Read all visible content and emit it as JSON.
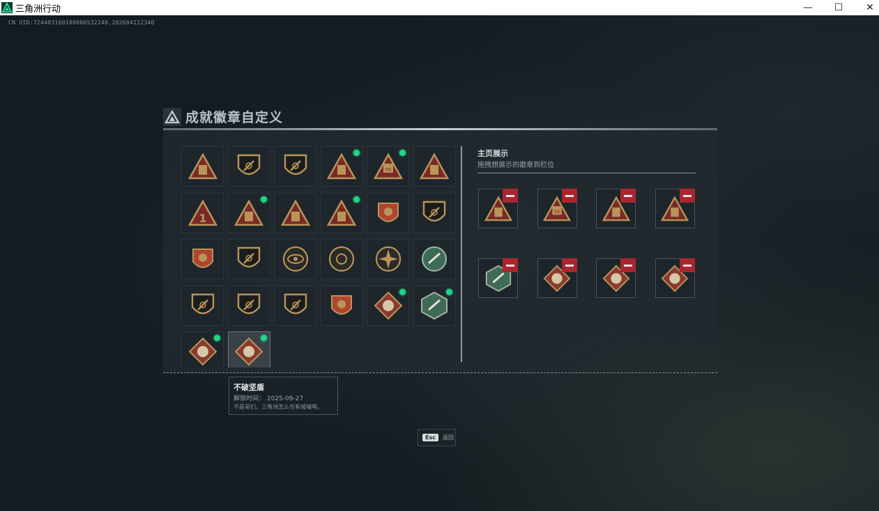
{
  "window": {
    "title": "三角洲行动",
    "minimize": "—",
    "maximize": "☐",
    "close": "✕"
  },
  "uid": "CN UID:7244031601000065322​40,20260411234​0",
  "header": {
    "title": "成就徽章自定义"
  },
  "badges": [
    {
      "icon": "shield-triangle-badge",
      "new": false
    },
    {
      "icon": "helicopter-shield-badge",
      "new": false
    },
    {
      "icon": "arrow-shield-badge",
      "new": false
    },
    {
      "icon": "bag-triangle-badge",
      "new": true
    },
    {
      "icon": "vest-56-badge",
      "new": true
    },
    {
      "icon": "helmet-triangle-badge",
      "new": false
    },
    {
      "icon": "number-1-badge",
      "new": false
    },
    {
      "icon": "box-triangle-badge",
      "new": true
    },
    {
      "icon": "tent-triangle-badge",
      "new": false
    },
    {
      "icon": "rocket-triangle-badge",
      "new": true
    },
    {
      "icon": "star-medal-badge",
      "new": false
    },
    {
      "icon": "hand-shield-badge",
      "new": false
    },
    {
      "icon": "winged-medal-badge",
      "new": false
    },
    {
      "icon": "beast-shield-badge",
      "new": false
    },
    {
      "icon": "eye-badge",
      "new": false
    },
    {
      "icon": "flower-badge",
      "new": false
    },
    {
      "icon": "compass-star-badge",
      "new": false
    },
    {
      "icon": "rifle-hex-badge",
      "new": false
    },
    {
      "icon": "rifle-shield-badge",
      "new": false
    },
    {
      "icon": "sniper-shield-badge",
      "new": false
    },
    {
      "icon": "gun-shield-badge",
      "new": false
    },
    {
      "icon": "crest-banner-badge",
      "new": false
    },
    {
      "icon": "beast-diamond-badge",
      "new": true
    },
    {
      "icon": "wasp-hex-badge",
      "new": true
    },
    {
      "icon": "dragon-diamond-badge",
      "new": true
    },
    {
      "icon": "armor-diamond-badge",
      "new": true
    }
  ],
  "showcase": {
    "title": "主页展示",
    "subtitle": "拖拽想展示的徽章到栏位",
    "slots": [
      {
        "icon": "box-triangle-badge"
      },
      {
        "icon": "vest-56-badge"
      },
      {
        "icon": "bag-triangle-badge"
      },
      {
        "icon": "rocket-triangle-badge"
      },
      {
        "icon": "wasp-hex-badge"
      },
      {
        "icon": "armor-diamond-badge"
      },
      {
        "icon": "dragon-diamond-badge"
      },
      {
        "icon": "beast-diamond-badge"
      }
    ]
  },
  "tooltip": {
    "name": "不破坚盾",
    "unlock_label": "解锁时间：",
    "unlock_date": "2025-09-27",
    "unlock_line": "解锁时间：  2025-09-27",
    "desc": "不是哥们，三角洲怎么也有城墙啊。"
  },
  "esc": {
    "key": "Esc",
    "label": "返回"
  },
  "colors": {
    "accent_new": "#1fd58a",
    "remove": "#a9262e",
    "badge_gold": "#b8955a",
    "badge_red": "#7a2a26",
    "badge_green": "#3e6b58"
  }
}
